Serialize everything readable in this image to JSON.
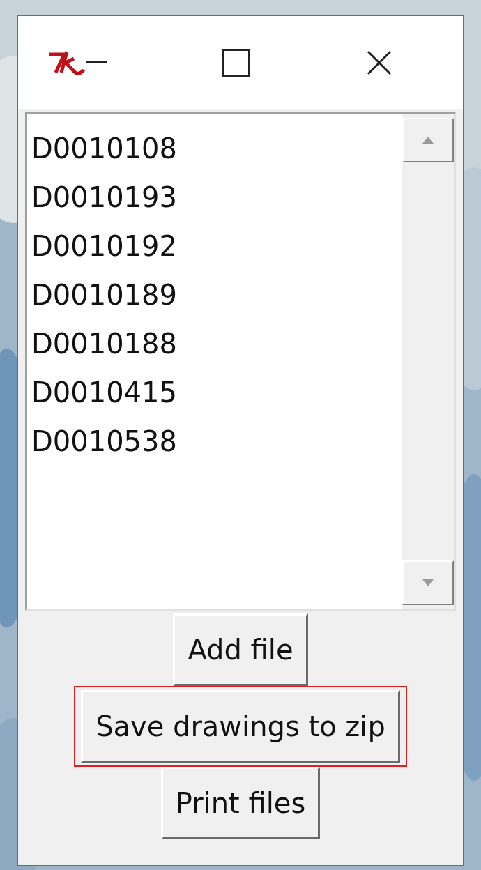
{
  "listbox": {
    "items": [
      "D0010108",
      "D0010193",
      "D0010192",
      "D0010189",
      "D0010188",
      "D0010415",
      "D0010538"
    ]
  },
  "buttons": [
    {
      "label": "Add file",
      "highlighted": false
    },
    {
      "label": "Save drawings to zip",
      "highlighted": true
    },
    {
      "label": "Print files",
      "highlighted": false
    }
  ]
}
